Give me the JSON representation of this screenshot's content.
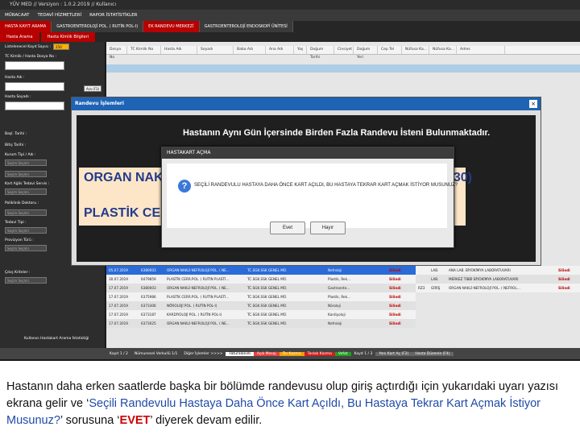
{
  "window": {
    "title": "YÜV MED // Versiyon : 1.0.2.2019 // Kullanıcı"
  },
  "menu": {
    "items": [
      "MÜRACAAT",
      "TEDAVİ HİZMETLERİ",
      "RAPOR İSTATİSTİKLER"
    ]
  },
  "tabs": [
    {
      "label": "HASTA KAYIT ARAMA"
    },
    {
      "label": "GASTROENTEROLOJİ POL. ( RUTİN POL-I)"
    },
    {
      "label": "EK RANDEVU MERKEZİ"
    },
    {
      "label": "GASTROENTEROLOJİ ENDOSKOPİ ÜNİTESİ"
    }
  ],
  "subtabs": [
    {
      "label": "Hasta Arama"
    },
    {
      "label": "Hasta Kimlik Bilgileri"
    }
  ],
  "left_panel": {
    "fields": [
      {
        "label": "Listelenecel Kayıt Sayısı :"
      },
      {
        "label": "TC Kimlik / Hasta Dosya No :"
      },
      {
        "label": "Hasta Adı :"
      },
      {
        "label": "Hasta Soyadı :"
      },
      {
        "label": "Başl. Tarihi :"
      },
      {
        "label": "Bitiş Tarihi :"
      },
      {
        "label": "Kurum Tipi / Adı :"
      },
      {
        "label": "Kart Ağlis Tedavi Servis :"
      },
      {
        "label": "Poliklinik Doktoru :"
      },
      {
        "label": "Tedavi Tipi :"
      },
      {
        "label": "Provizyon Türü :"
      },
      {
        "label": "Çıkış Kriteler :"
      }
    ],
    "search_label": "Ara (F3)",
    "combo_placeholder": "Seçim Seçimi",
    "count_value": "250"
  },
  "grid_header": [
    "Dosya No",
    "TC Kimlik No",
    "Hasta Adı",
    "Soyadı",
    "Baba Adı",
    "Ana Adı",
    "Yaş",
    "Doğum Tarihi",
    "Cinsiyet",
    "Doğum Yeri",
    "Cep Tel",
    "Nüfusa Ka...",
    "Nüfusa Ka...",
    "Adres"
  ],
  "randevu_dialog": {
    "title": "Randevu İşlemleri",
    "message": "Hastanın Aynı Gün İçersinde Birden Fazla Randevu İsteni Bulunmaktadır.",
    "line1": "ORGAN NAKLİ-N",
    "line1_end": "30)",
    "line2": "PLASTİK CERR.PO"
  },
  "hastakart_dialog": {
    "title": "HASTAKART AÇMA",
    "message": "SEÇİLİ RANDEVULU HASTAYA DAHA ÖNCE KART AÇILDI, BU HASTAYA TEKRAR KART AÇMAK İSTİYOR MUSUNUZ?",
    "yes_label": "Evet",
    "no_label": "Hayır"
  },
  "bottom_rows": [
    {
      "date": "05.07.2019",
      "no": "6380003",
      "clinic": "ORGAN NAKLİ-NEFROLOJİ POL. ( NE...",
      "kurum": "TC.SGK.SSK GENEL MÜ.",
      "dr": "Nefroloji",
      "st": "Silindi"
    },
    {
      "date": "30.07.2019",
      "no": "6479859",
      "clinic": "PLASTİK CERR.POL. ( RUTİN PLASTİ...",
      "kurum": "TC.SGK.SSK GENEL MÜ.",
      "dr": "Plastik, Rek...",
      "st": "Silindi"
    },
    {
      "date": "17.07.2019",
      "no": "6380003",
      "clinic": "ORGAN NAKLİ-NEFROLOJİ POL. ( NE...",
      "kurum": "TC.SGK.SSK GENEL MÜ.",
      "dr": "Gastroente...",
      "st": "Silindi"
    },
    {
      "date": "17.07.2019",
      "no": "6375986",
      "clinic": "PLASTİK CERR.POL. ( RUTİN PLASTİ...",
      "kurum": "TC.SGK.SSK GENEL MÜ.",
      "dr": "Plastik, Rek...",
      "st": "Silindi"
    },
    {
      "date": "17.07.2019",
      "no": "6373306",
      "clinic": "NÖROLOJİ POL. ( RUTİN POL-I)",
      "kurum": "TC.SGK.SSK GENEL MÜ.",
      "dr": "Nöroloji",
      "st": "Silindi"
    },
    {
      "date": "17.07.2019",
      "no": "6373187",
      "clinic": "KARDİYOLOJİ POL. ( RUTİN POL-I)",
      "kurum": "TC.SGK.SSK GENEL MÜ.",
      "dr": "Kardiyoloji",
      "st": "Silindi"
    },
    {
      "date": "17.07.2019",
      "no": "6373025",
      "clinic": "ORGAN NAKLİ-NEFROLOJİ POL. ( NE...",
      "kurum": "TC.SGK.SSK GENEL MÜ.",
      "dr": "Nefroloji",
      "st": "Silindi"
    }
  ],
  "right_rows": [
    {
      "no": "",
      "type": "LAB.",
      "desc": "ANA LAB. BİYOKİMYA LABORATUVARI",
      "st": "Silindi"
    },
    {
      "no": "",
      "type": "LAB.",
      "desc": "MERKEZ TIBBİ BİYOKİMYA LABORATUVARI",
      "st": "Silindi"
    },
    {
      "no": "RZ3",
      "type": "GİRİŞ",
      "desc": "ORGAN NAKLİ-NEFROLOJİ POL. ( NEFROL...",
      "st": "Silindi"
    }
  ],
  "status_bar": {
    "footer_label": "Kullanıcı Hastakart Arama İstatistiği",
    "items": [
      "Nümunesel Verkullü 1/1",
      "Diğer İşlemler >>>>",
      "Faturalanıdı",
      "Açık Mesaj",
      "Ön Kazma",
      "Taslak Kazma",
      "Vefat"
    ],
    "kayit": "Kayıt 1 / 2",
    "pager": "Kayıt 1 / 3",
    "new_card": "Yeni Kart Aç (F2)",
    "edit_card": "Hasta Düzenle (F4)"
  },
  "caption": {
    "part1": "Hastanın daha erken saatlerde başka bir bölümde randevusu olup giriş açtırdığı için yukarıdaki uyarı yazısı ekrana gelir ve ‘",
    "part2": "Seçili Randevulu Hastaya Daha Önce Kart Açıldı, Bu Hastaya Tekrar Kart Açmak İstiyor Musunuz?",
    "part3": "’ sorusuna ‘",
    "part4": "EVET",
    "part5": "’ diyerek devam edilir."
  }
}
